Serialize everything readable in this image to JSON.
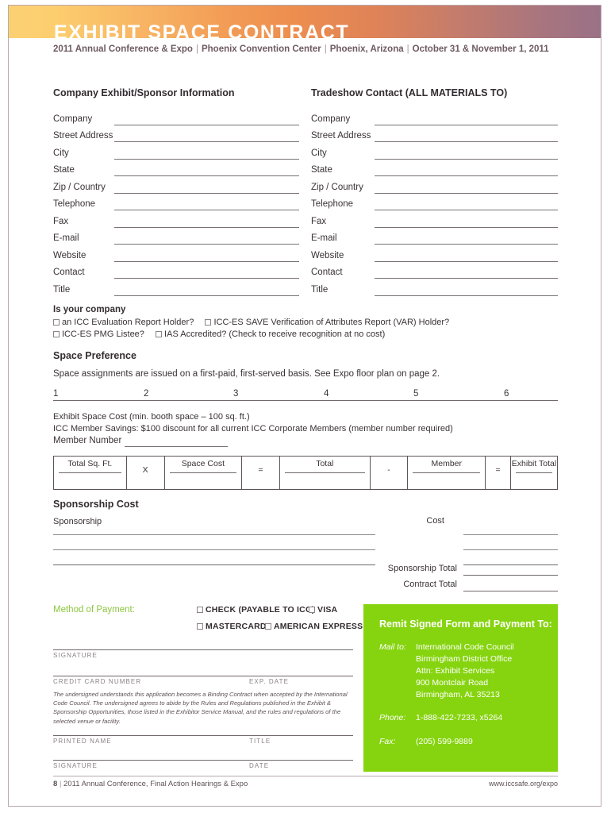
{
  "header": {
    "title": "EXHIBIT SPACE CONTRACT",
    "subtitle_parts": [
      "2011 Annual Conference & Expo",
      "Phoenix Convention Center",
      "Phoenix, Arizona",
      "October 31 & November 1, 2011"
    ],
    "gradient_start": "#fbd074",
    "gradient_mid": "#ed8e4f",
    "gradient_end": "#9a7186"
  },
  "company_section": {
    "heading": "Company Exhibit/Sponsor Information",
    "fields": [
      "Company",
      "Street Address",
      "City",
      "State",
      "Zip / Country",
      "Telephone",
      "Fax",
      "E-mail",
      "Website",
      "Contact",
      "Title"
    ]
  },
  "tradeshow_section": {
    "heading": "Tradeshow Contact (ALL MATERIALS TO)",
    "fields": [
      "Company",
      "Street Address",
      "City",
      "State",
      "Zip / Country",
      "Telephone",
      "Fax",
      "E-mail",
      "Website",
      "Contact",
      "Title"
    ]
  },
  "is_your_company": {
    "heading": "Is your company",
    "line1_opt1": "an ICC Evaluation Report Holder?",
    "line1_opt2": "ICC-ES SAVE Verification of Attributes Report (VAR) Holder?",
    "line2_opt1": "ICC-ES PMG Listee?",
    "line2_opt2": "IAS Accredited? (Check to receive recognition at no cost)"
  },
  "space_preference": {
    "heading": "Space Preference",
    "note": "Space assignments are issued on a first-paid, first-served basis.  See Expo floor plan on page 2.",
    "numbers": [
      "1",
      "2",
      "3",
      "4",
      "5",
      "6"
    ],
    "cost_line1": "Exhibit Space Cost (min. booth space – 100 sq. ft.)",
    "cost_line2": "ICC Member Savings: $100 discount for all current ICC Corporate Members (member number required)",
    "member_number_label": "Member Number"
  },
  "calc_table": {
    "cells": [
      {
        "label": "Total Sq. Ft.",
        "type": "field"
      },
      {
        "label": "X",
        "type": "op"
      },
      {
        "label": "Space Cost",
        "type": "field"
      },
      {
        "label": "=",
        "type": "op"
      },
      {
        "label": "Total",
        "type": "field"
      },
      {
        "label": "-",
        "type": "op"
      },
      {
        "label": "Member",
        "type": "field"
      },
      {
        "label": "=",
        "type": "op"
      },
      {
        "label": "Exhibit Total",
        "type": "field"
      }
    ]
  },
  "sponsorship": {
    "heading": "Sponsorship Cost",
    "col_left_label": "Sponsorship",
    "col_right_label": "Cost",
    "total_label": "Sponsorship Total",
    "contract_total_label": "Contract Total"
  },
  "payment": {
    "heading": "Method of Payment:",
    "heading_color": "#8cc63f",
    "options": [
      "CHECK (PAYABLE TO ICC)",
      "VISA",
      "MASTERCARD",
      "AMERICAN EXPRESS"
    ],
    "signature_caption": "SIGNATURE",
    "credit_card_caption": "CREDIT CARD NUMBER",
    "exp_date_caption": "EXP. DATE",
    "legal_text": "The undersigned understands this application becomes a Binding Contract when accepted by the International Code Council. The undersigned agrees to abide by the Rules and Regulations published in the Exhibit & Sponsorship Opportunities, those listed in the Exhibitor Service Manual, and the rules and regulations of the selected venue or facility.",
    "printed_name_caption": "PRINTED NAME",
    "title_caption": "TITLE",
    "signature2_caption": "SIGNATURE",
    "date_caption": "DATE"
  },
  "remit": {
    "background_color": "#86d40f",
    "title": "Remit Signed Form and Payment To:",
    "mail_to_label": "Mail to:",
    "address_lines": [
      "International Code Council",
      "Birmingham District Office",
      "Attn: Exhibit Services",
      "900 Montclair Road",
      "Birmingham, AL 35213"
    ],
    "phone_label": "Phone:",
    "phone_value": "1-888-422-7233, x5264",
    "fax_label": "Fax:",
    "fax_value": "(205) 599-9889"
  },
  "footer": {
    "page_number": "8",
    "separator": "|",
    "left_text": "2011 Annual Conference, Final Action Hearings & Expo",
    "right_text": "www.iccsafe.org/expo"
  }
}
